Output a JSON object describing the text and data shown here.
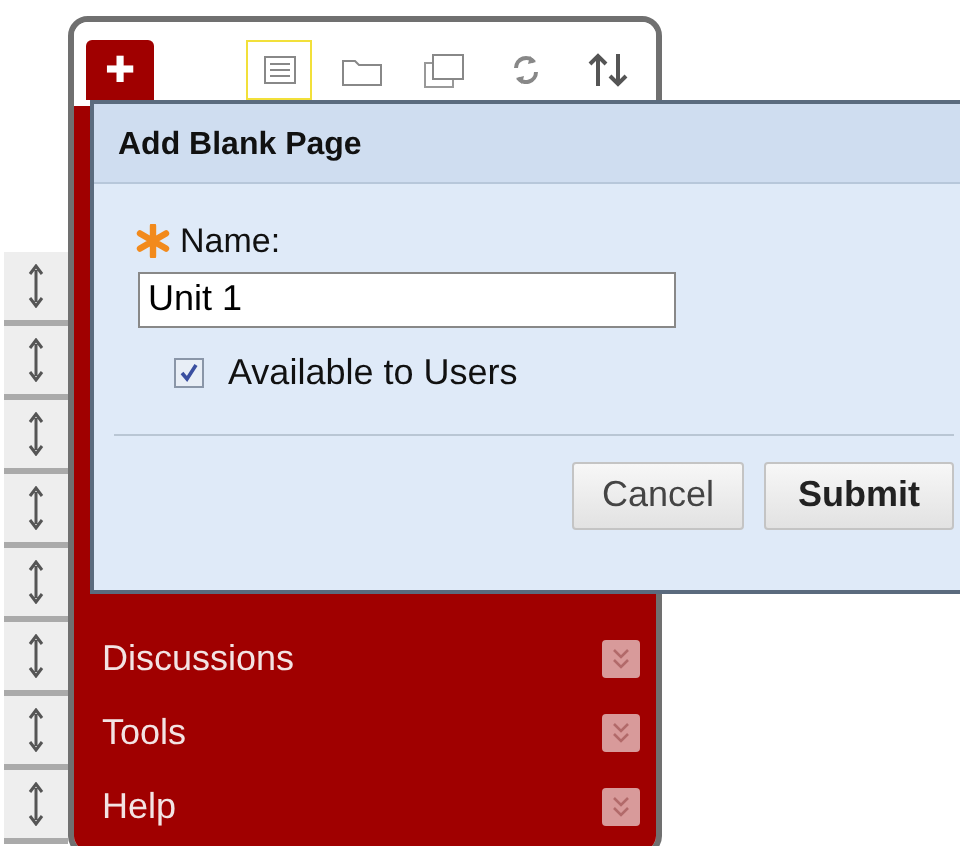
{
  "toolbar": {
    "add_button": {
      "label": "✚"
    },
    "buttons": [
      {
        "kind": "list",
        "selected": true
      },
      {
        "kind": "folder",
        "selected": false
      },
      {
        "kind": "windows",
        "selected": false
      },
      {
        "kind": "refresh",
        "selected": false
      },
      {
        "kind": "sort",
        "selected": false
      }
    ]
  },
  "menu": {
    "items": [
      {
        "label": "Discussions"
      },
      {
        "label": "Tools"
      },
      {
        "label": "Help"
      }
    ]
  },
  "dialog": {
    "title": "Add Blank Page",
    "name_label": "Name:",
    "required": true,
    "name_value": "Unit 1",
    "available": {
      "label": "Available to Users",
      "checked": true
    },
    "buttons": [
      {
        "label": "Cancel",
        "kind": "default"
      },
      {
        "label": "Submit",
        "kind": "primary"
      }
    ]
  }
}
